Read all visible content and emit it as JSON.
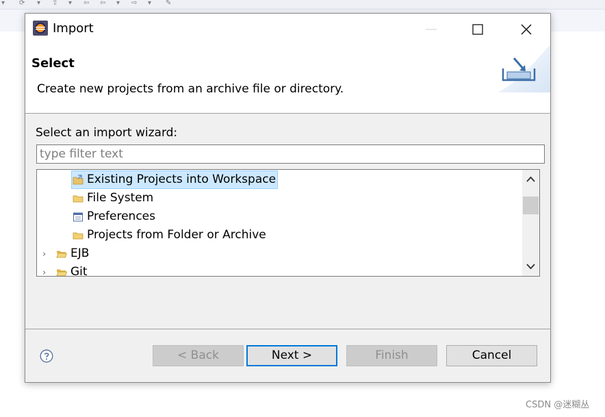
{
  "dialog": {
    "title": "Import",
    "banner_title": "Select",
    "banner_description": "Create new projects from an archive file or directory.",
    "prompt": "Select an import wizard:"
  },
  "filter": {
    "placeholder": "type filter text",
    "value": ""
  },
  "tree": {
    "items": [
      {
        "label": "Existing Projects into Workspace",
        "icon": "import-project-icon",
        "selected": true,
        "level": 2
      },
      {
        "label": "File System",
        "icon": "folder-icon",
        "selected": false,
        "level": 2
      },
      {
        "label": "Preferences",
        "icon": "preferences-icon",
        "selected": false,
        "level": 2
      },
      {
        "label": "Projects from Folder or Archive",
        "icon": "folder-icon",
        "selected": false,
        "level": 2
      },
      {
        "label": "EJB",
        "icon": "folder-open-icon",
        "selected": false,
        "level": 1,
        "expandable": true
      },
      {
        "label": "Git",
        "icon": "folder-open-icon",
        "selected": false,
        "level": 1,
        "expandable": true
      }
    ]
  },
  "buttons": {
    "back": "< Back",
    "next": "Next >",
    "finish": "Finish",
    "cancel": "Cancel"
  },
  "watermark": "CSDN @迷糊丛",
  "colors": {
    "selection_bg": "#cce8ff",
    "selection_border": "#99d1ff",
    "default_button_border": "#0078d7",
    "dialog_bg": "#f0f0f0"
  }
}
